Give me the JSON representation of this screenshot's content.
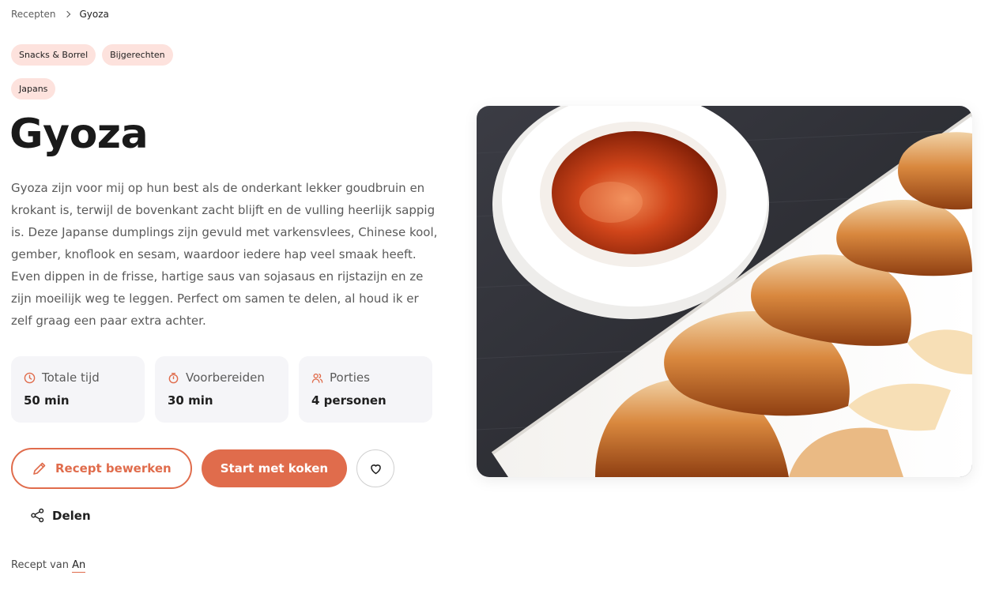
{
  "breadcrumb": {
    "parent": "Recepten",
    "current": "Gyoza"
  },
  "tags": [
    "Snacks & Borrel",
    "Bijgerechten",
    "Japans"
  ],
  "recipe": {
    "title": "Gyoza",
    "description": "Gyoza zijn voor mij op hun best als de onderkant lekker goudbruin en krokant is, terwijl de bovenkant zacht blijft en de vulling heerlijk sappig is. Deze Japanse dumplings zijn gevuld met varkensvlees, Chinese kool, gember, knoflook en sesam, waardoor iedere hap veel smaak heeft. Even dippen in de frisse, hartige saus van sojasaus en rijstazijn en ze zijn moeilijk weg te leggen. Perfect om samen te delen, al houd ik er zelf graag een paar extra achter."
  },
  "stats": [
    {
      "icon": "clock-icon",
      "label": "Totale tijd",
      "value": "50 min"
    },
    {
      "icon": "timer-icon",
      "label": "Voorbereiden",
      "value": "30 min"
    },
    {
      "icon": "users-icon",
      "label": "Porties",
      "value": "4 personen"
    }
  ],
  "actions": {
    "edit_label": "Recept bewerken",
    "start_label": "Start met koken",
    "favorite_icon": "heart-icon",
    "share_label": "Delen"
  },
  "author": {
    "prefix": "Recept van",
    "name": "An"
  },
  "colors": {
    "accent": "#e06c4c",
    "tag_bg": "#fde2dd",
    "card_bg": "#f5f5f8"
  }
}
